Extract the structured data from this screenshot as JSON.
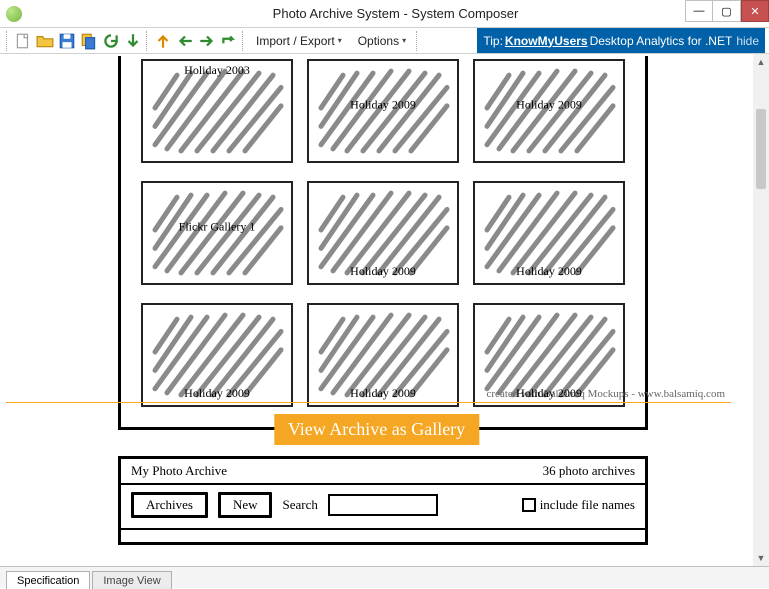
{
  "window": {
    "title": "Photo Archive System - System Composer"
  },
  "menu": {
    "import_export": "Import / Export",
    "options": "Options"
  },
  "tip": {
    "prefix": "Tip: ",
    "link": "KnowMyUsers",
    "suffix": " Desktop Analytics for .NET",
    "hide": "hide"
  },
  "gallery": [
    {
      "label": "Holiday 2003",
      "pos": "top"
    },
    {
      "label": "Holiday 2009",
      "pos": "mid"
    },
    {
      "label": "Holiday 2009",
      "pos": "mid"
    },
    {
      "label": "Flickr Gallery 1",
      "pos": "mid"
    },
    {
      "label": "Holiday 2009",
      "pos": "low"
    },
    {
      "label": "Holiday 2009",
      "pos": "low"
    },
    {
      "label": "Holiday 2009",
      "pos": "low"
    },
    {
      "label": "Holiday 2009",
      "pos": "low"
    },
    {
      "label": "Holiday 2009",
      "pos": "low"
    }
  ],
  "credit": "created with Balsamiq Mockups - www.balsamiq.com",
  "banner": "View Archive as Gallery",
  "panel": {
    "title": "My Photo Archive",
    "count": "36 photo archives",
    "archives_btn": "Archives",
    "new_btn": "New",
    "search_label": "Search",
    "include_label": "include file names"
  },
  "tabs": {
    "spec": "Specification",
    "image": "Image View"
  }
}
